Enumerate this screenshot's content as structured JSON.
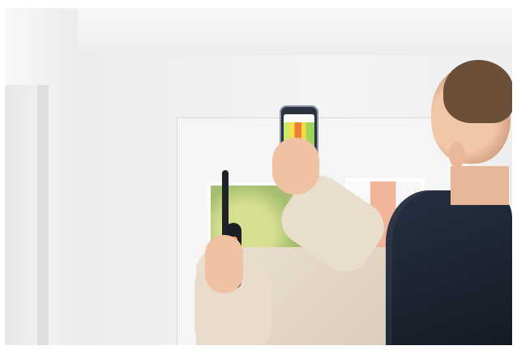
{
  "scene": {
    "description": "",
    "phone_screen": {
      "heatmap_colors": [
        "#cbe96c",
        "#f2e14b",
        "#ef7d35",
        "#9cd35c"
      ]
    },
    "device_colors": {
      "probe": "#1b1e22",
      "probe_accent": "#f28b22",
      "phone": "#2c3340"
    }
  }
}
